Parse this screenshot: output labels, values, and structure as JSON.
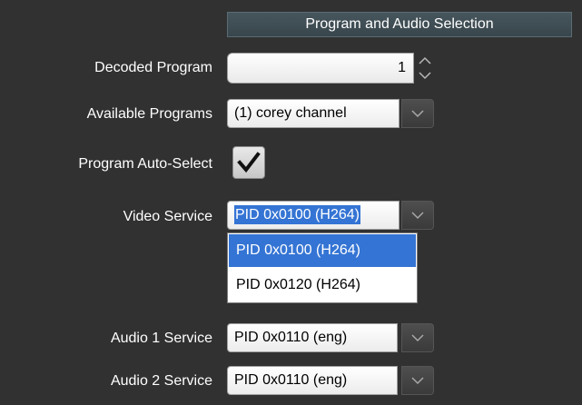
{
  "panel": {
    "title": "Program and Audio Selection"
  },
  "decoded_program": {
    "label": "Decoded Program",
    "value": "1"
  },
  "available_programs": {
    "label": "Available Programs",
    "selected": "(1) corey channel"
  },
  "program_auto_select": {
    "label": "Program Auto-Select",
    "checked": true
  },
  "video_service": {
    "label": "Video Service",
    "selected": "PID 0x0100 (H264)",
    "options": [
      "PID 0x0100 (H264)",
      "PID 0x0120 (H264)"
    ],
    "highlighted_index": 0
  },
  "audio1_service": {
    "label": "Audio 1 Service",
    "selected": "PID 0x0110 (eng)"
  },
  "audio2_service": {
    "label": "Audio 2 Service",
    "selected": "PID 0x0110 (eng)"
  },
  "colors": {
    "background": "#313131",
    "header": "#3f4e55",
    "selection": "#3474d4"
  }
}
